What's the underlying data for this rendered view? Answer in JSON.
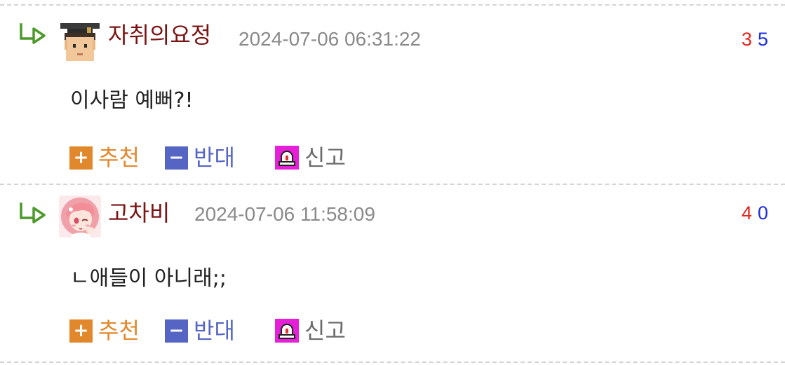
{
  "comments": [
    {
      "nickname": "자취의요정",
      "timestamp": "2024-07-06 06:31:22",
      "upvotes": "3",
      "downvotes": "5",
      "content": "이사람 예뻐?!",
      "avatar_icon": "graduate-pixel-avatar-icon"
    },
    {
      "nickname": "고차비",
      "timestamp": "2024-07-06 11:58:09",
      "upvotes": "4",
      "downvotes": "0",
      "content": "ㄴ애들이 아니래;;",
      "avatar_icon": "pink-hair-girl-avatar-icon"
    }
  ],
  "actions": {
    "upvote_label": "추천",
    "downvote_label": "반대",
    "report_label": "신고",
    "upvote_symbol": "+",
    "downvote_symbol": "−"
  },
  "colors": {
    "nickname": "#7a1414",
    "timestamp": "#8a8a8a",
    "upvote": "#e2882c",
    "downvote": "#5565c4",
    "count_up": "#e3261c",
    "count_down": "#1a2be0",
    "report_bg": "#e620d8",
    "reply_arrow": "#4c9a2a"
  }
}
